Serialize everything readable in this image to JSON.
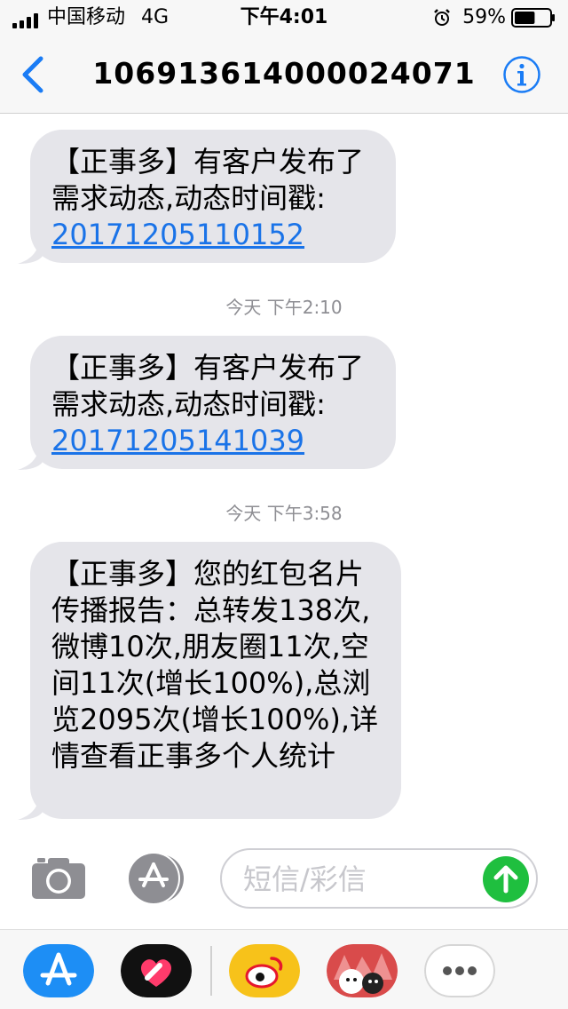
{
  "status_bar": {
    "carrier": "中国移动",
    "network": "4G",
    "time": "下午4:01",
    "battery_percent": "59%",
    "battery_level": 0.59
  },
  "nav": {
    "title": "106913614000024071",
    "back_icon": "chevron-left-icon",
    "info_icon": "info-icon",
    "accent_color": "#1a7cf5"
  },
  "messages": [
    {
      "text": "【正事多】有客户发布了需求动态,动态时间戳:",
      "link": "20171205110152"
    },
    {
      "timestamp_day": "今天",
      "timestamp_time": "下午2:10",
      "text": "【正事多】有客户发布了需求动态,动态时间戳:",
      "link": "20171205141039"
    },
    {
      "timestamp_day": "今天",
      "timestamp_time": "下午3:58",
      "text": "【正事多】您的红包名片传播报告：总转发138次,微博10次,朋友圈11次,空间11次(增长100%),总浏览2095次(增长100%),详情查看正事多个人统计"
    }
  ],
  "compose": {
    "placeholder": "短信/彩信",
    "camera_icon": "camera-icon",
    "apps_icon": "app-store-icon",
    "send_icon": "send-arrow-icon",
    "send_color": "#1fbf3f"
  },
  "app_drawer": {
    "apps": [
      "app-store-icon",
      "digital-touch-icon",
      "weibo-icon",
      "stickers-icon",
      "more-icon"
    ]
  }
}
